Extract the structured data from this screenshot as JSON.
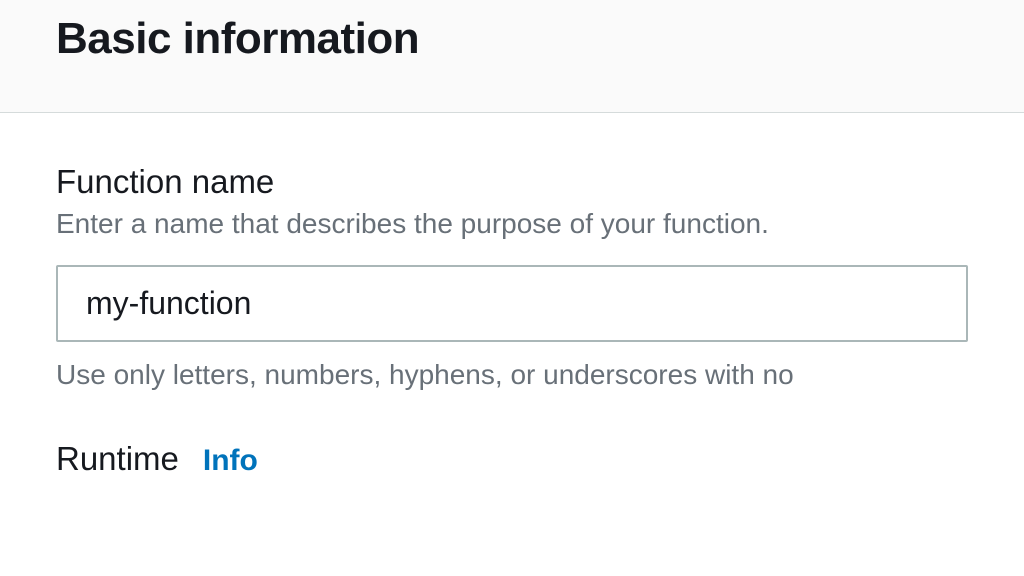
{
  "header": {
    "title": "Basic information"
  },
  "form": {
    "functionName": {
      "label": "Function name",
      "description": "Enter a name that describes the purpose of your function.",
      "value": "my-function",
      "constraint": "Use only letters, numbers, hyphens, or underscores with no"
    },
    "runtime": {
      "label": "Runtime",
      "infoLabel": "Info"
    }
  }
}
